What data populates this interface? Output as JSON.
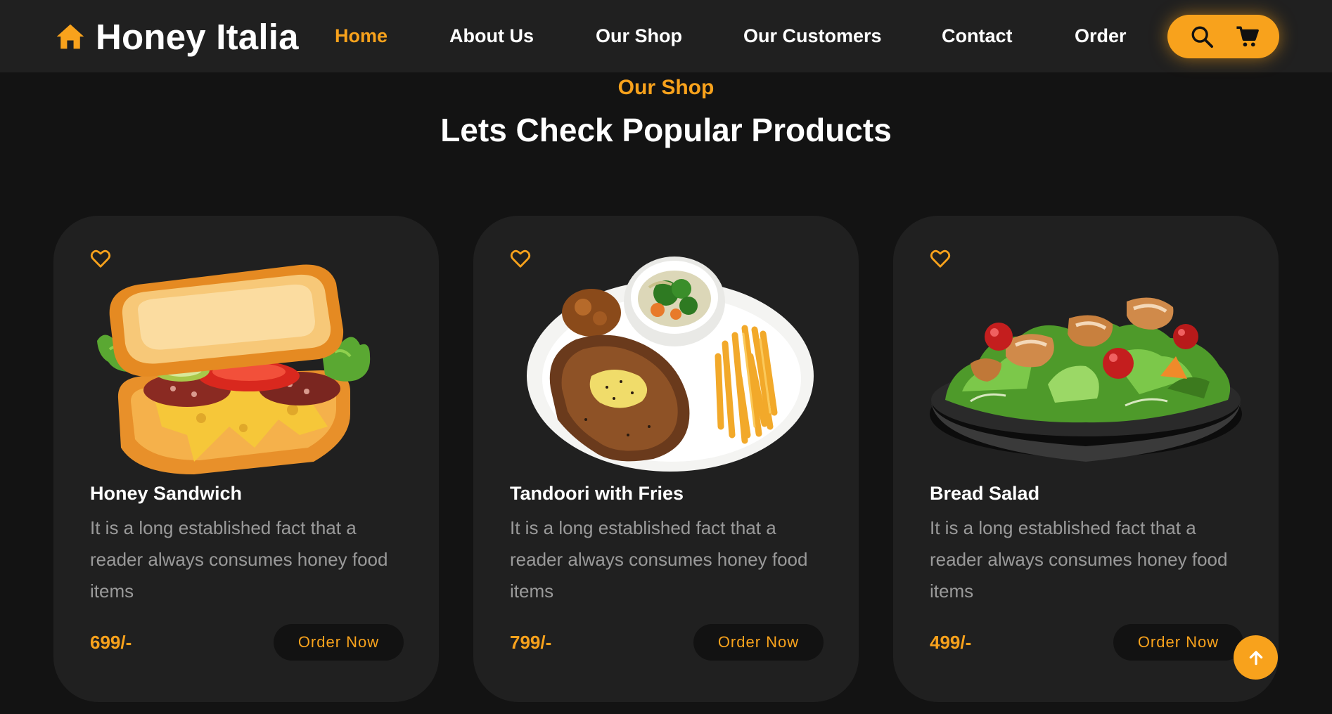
{
  "header": {
    "brand": {
      "name": "Honey Italia",
      "icon": "home-icon"
    },
    "nav": [
      {
        "label": "Home",
        "active": true
      },
      {
        "label": "About Us",
        "active": false
      },
      {
        "label": "Our Shop",
        "active": false
      },
      {
        "label": "Our Customers",
        "active": false
      },
      {
        "label": "Contact",
        "active": false
      },
      {
        "label": "Order",
        "active": false
      }
    ],
    "actions": {
      "search_icon": "search-icon",
      "cart_icon": "cart-icon"
    }
  },
  "section": {
    "eyebrow": "Our Shop",
    "title": "Lets Check Popular Products"
  },
  "products": [
    {
      "name": "Honey Sandwich",
      "description": "It is a long established fact that a reader always consumes honey food items",
      "price": "699/-",
      "button": "Order Now",
      "image": "sandwich-image",
      "favorite_icon": "heart-icon"
    },
    {
      "name": "Tandoori with Fries",
      "description": "It is a long established fact that a reader always consumes honey food items",
      "price": "799/-",
      "button": "Order Now",
      "image": "steak-fries-image",
      "favorite_icon": "heart-icon"
    },
    {
      "name": "Bread Salad",
      "description": "It is a long established fact that a reader always consumes honey food items",
      "price": "499/-",
      "button": "Order Now",
      "image": "salad-image",
      "favorite_icon": "heart-icon"
    }
  ],
  "scroll_top_icon": "arrow-up-icon",
  "colors": {
    "accent": "#f8a21c",
    "background": "#131313",
    "surface": "#202020",
    "muted_text": "#9a9a9a"
  }
}
